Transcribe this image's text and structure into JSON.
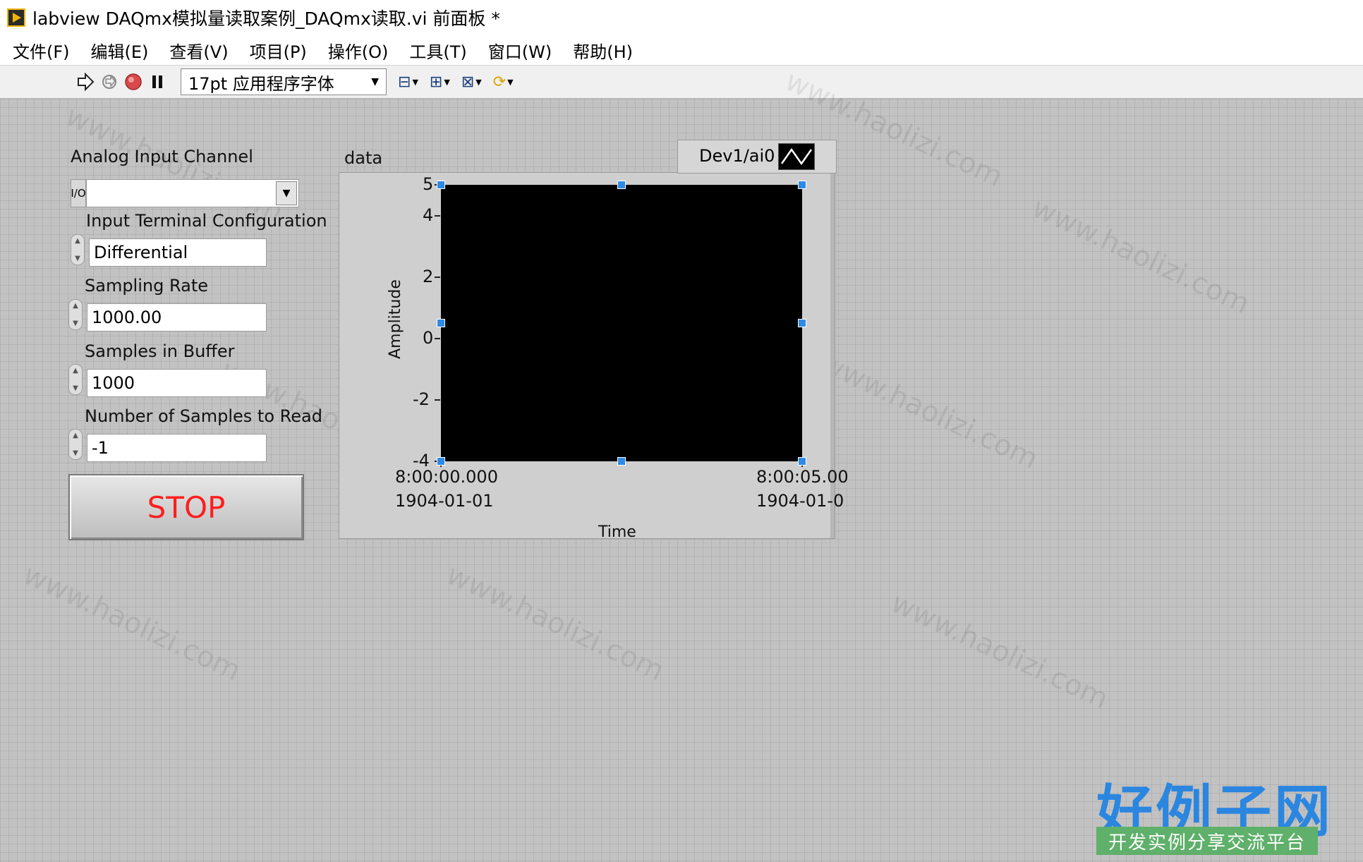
{
  "window": {
    "title": "labview DAQmx模拟量读取案例_DAQmx读取.vi 前面板 *"
  },
  "menu": [
    "文件(F)",
    "编辑(E)",
    "查看(V)",
    "项目(P)",
    "操作(O)",
    "工具(T)",
    "窗口(W)",
    "帮助(H)"
  ],
  "toolbar": {
    "run_icon": "run-arrow-icon",
    "run_continuous_icon": "run-continuously-icon",
    "abort_icon": "abort-icon",
    "pause_icon": "pause-icon",
    "font_select": "17pt 应用程序字体"
  },
  "front_panel": {
    "analog_input_channel": {
      "label": "Analog Input Channel",
      "value": "",
      "prefix": "I/O"
    },
    "input_terminal_configuration": {
      "label": "Input Terminal Configuration",
      "value": "Differential"
    },
    "sampling_rate": {
      "label": "Sampling Rate",
      "value": "1000.00"
    },
    "samples_in_buffer": {
      "label": "Samples in Buffer",
      "value": "1000"
    },
    "number_of_samples_to_read": {
      "label": "Number of Samples to Read",
      "value": "-1"
    },
    "stop_button": {
      "label": "STOP",
      "color": "#ff1e1e"
    }
  },
  "chart_data": {
    "type": "line",
    "title": "data",
    "legend": [
      {
        "name": "Dev1/ai0",
        "color": "#ffffff"
      }
    ],
    "xlabel": "Time",
    "ylabel": "Amplitude",
    "x_ticks": [
      {
        "time": "8:00:00.000",
        "date": "1904-01-01"
      },
      {
        "time": "8:00:05.00",
        "date": "1904-01-0"
      }
    ],
    "y_ticks": [
      "5",
      "4",
      "2",
      "0",
      "-2",
      "-4"
    ],
    "ylim": [
      -4,
      5
    ],
    "series": [
      {
        "name": "Dev1/ai0",
        "values": []
      }
    ],
    "plot_background": "#000000"
  },
  "watermark": {
    "text": "www.haolizi.com"
  },
  "logo": {
    "main": "好例子网",
    "sub": "开发实例分享交流平台"
  }
}
